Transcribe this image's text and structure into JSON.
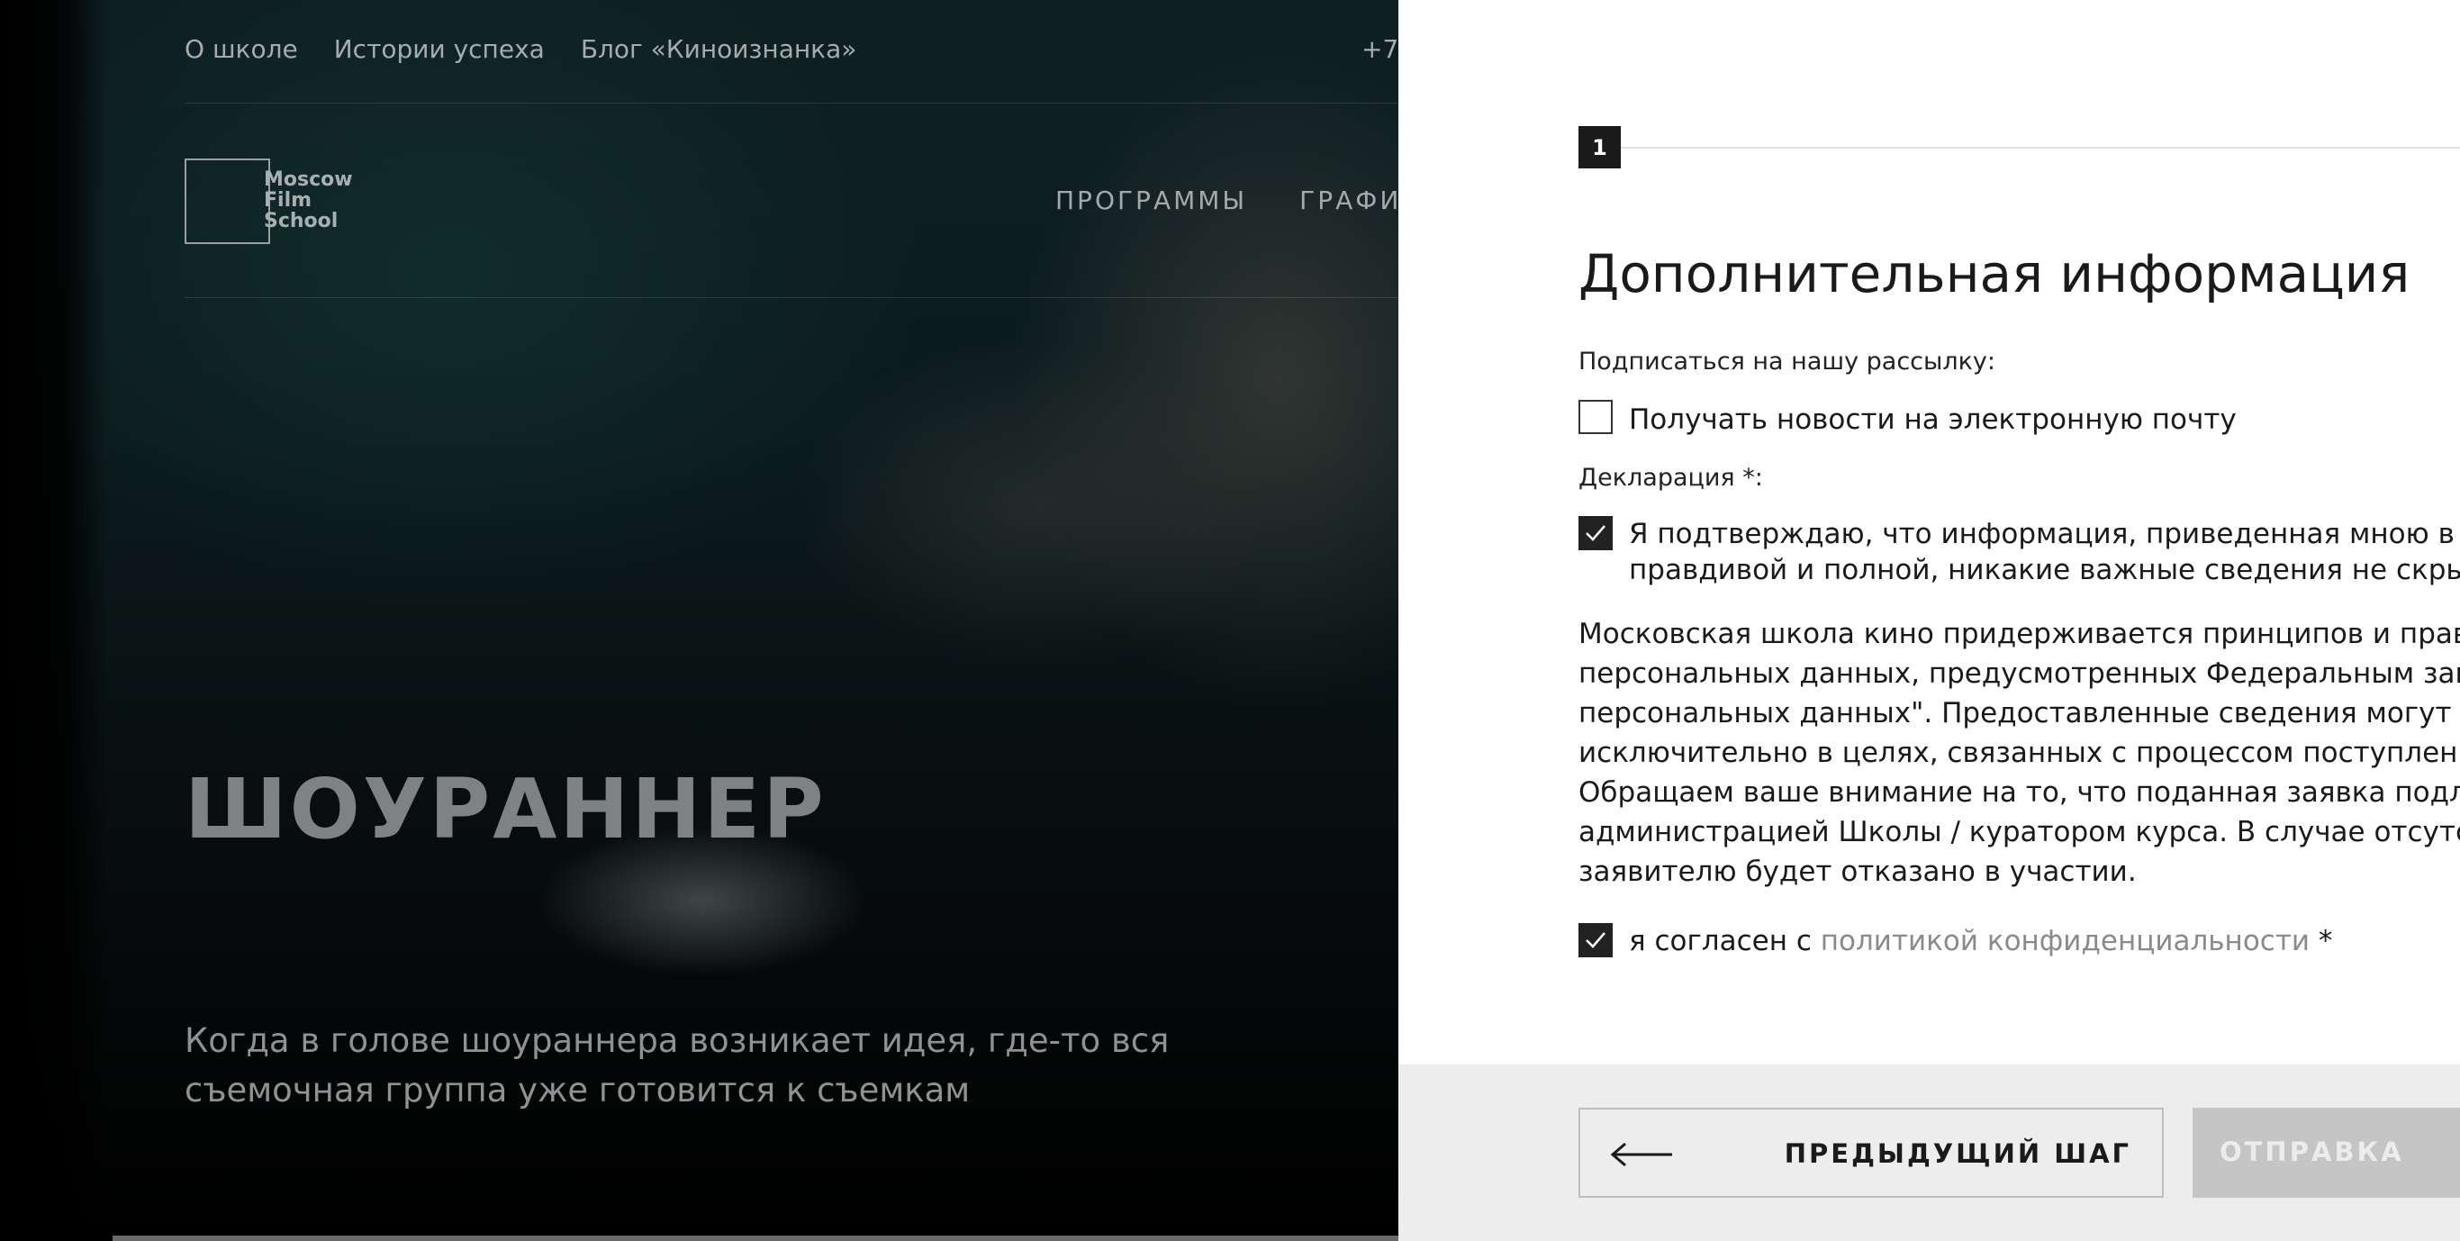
{
  "site": {
    "topnav": [
      "О школе",
      "Истории успеха",
      "Блог «Киноизнанка»"
    ],
    "phone": "+7",
    "logo": {
      "line1": "Moscow",
      "line2": "Film",
      "line3": "School"
    },
    "mainnav": [
      "ПРОГРАММЫ",
      "ГРАФИ"
    ],
    "hero_title": "ШОУРАННЕР",
    "hero_sub_line1": "Когда в голове шоураннера возникает идея, где-то вся",
    "hero_sub_line2": "съемочная группа уже готовится к съемкам"
  },
  "panel": {
    "step_number": "1",
    "title": "Дополнительная информация",
    "subscribe_label": "Подписаться на нашу рассылку:",
    "subscribe_checkbox": {
      "label": "Получать новости на электронную почту",
      "checked": false
    },
    "declaration_label": "Декларация *:",
    "declaration_checkbox": {
      "line1": "Я подтверждаю, что информация, приведенная мною в данн",
      "line2": "правдивой и полной, никакие важные сведения не скрыты и",
      "checked": true
    },
    "paragraph": [
      "Московская школа кино придерживается принципов и правил о",
      "персональных данных, предусмотренных Федеральным законо",
      "персональных данных\". Предоставленные сведения могут быть",
      "исключительно в целях, связанных с процессом поступления и о",
      "Обращаем ваше внимание на то, что поданная заявка подлежит",
      "администрацией Школы / куратором курса. В случае отсутствия",
      "заявителю будет отказано в участии."
    ],
    "agree_checkbox": {
      "prefix": "я согласен с ",
      "link": "политикой конфиденциальности",
      "suffix": " *",
      "checked": true
    },
    "prev_button": "ПРЕДЫДУЩИЙ ШАГ",
    "send_button": "ОТПРАВКА"
  }
}
